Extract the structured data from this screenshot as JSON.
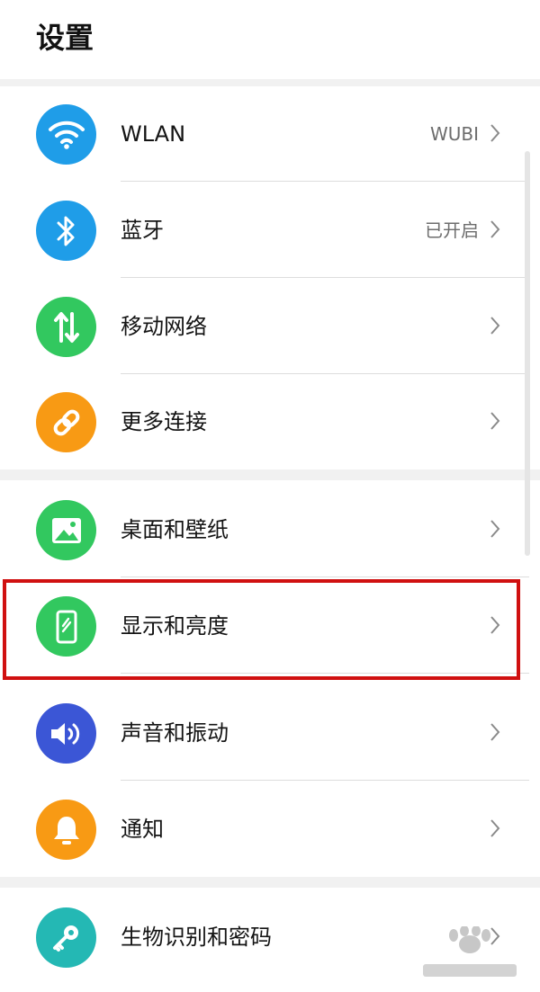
{
  "header": {
    "title": "设置"
  },
  "settings": {
    "items": [
      {
        "label": "WLAN",
        "value": "WUBI",
        "icon": "wifi-icon",
        "icon_bg": "#1f9de8"
      },
      {
        "label": "蓝牙",
        "value": "已开启",
        "icon": "bluetooth-icon",
        "icon_bg": "#1f9de8"
      },
      {
        "label": "移动网络",
        "value": "",
        "icon": "mobile-data-icon",
        "icon_bg": "#32c85f"
      },
      {
        "label": "更多连接",
        "value": "",
        "icon": "link-icon",
        "icon_bg": "#f89a14"
      },
      {
        "label": "桌面和壁纸",
        "value": "",
        "icon": "image-icon",
        "icon_bg": "#32c85f"
      },
      {
        "label": "显示和亮度",
        "value": "",
        "icon": "phone-display-icon",
        "icon_bg": "#32c85f"
      },
      {
        "label": "声音和振动",
        "value": "",
        "icon": "speaker-icon",
        "icon_bg": "#3b56d6"
      },
      {
        "label": "通知",
        "value": "",
        "icon": "bell-icon",
        "icon_bg": "#f89a14"
      },
      {
        "label": "生物识别和密码",
        "value": "",
        "icon": "key-icon",
        "icon_bg": "#24b8b4"
      }
    ]
  },
  "colors": {
    "highlight_box": "#d01010",
    "section_gap": "#f1f1f1"
  }
}
